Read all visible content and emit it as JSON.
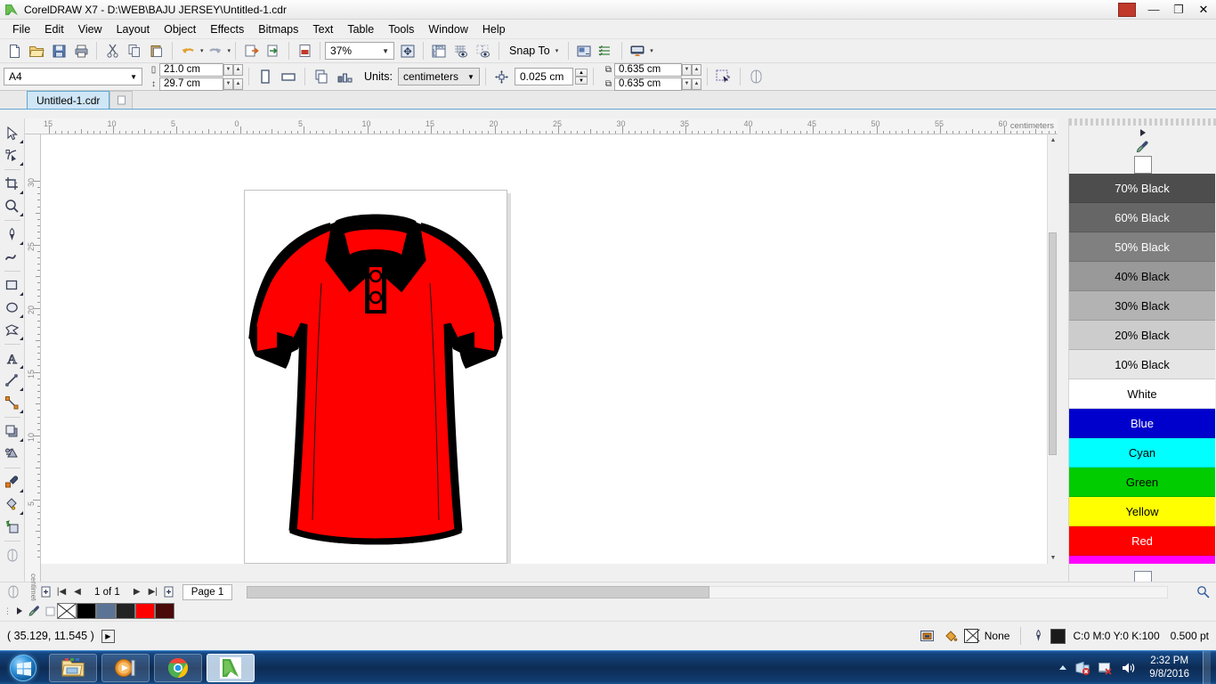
{
  "window": {
    "title": "CorelDRAW X7 - D:\\WEB\\BAJU JERSEY\\Untitled-1.cdr",
    "app_icon": "coreldraw-icon",
    "minimize": "—",
    "maximize": "❐",
    "close": "✕"
  },
  "menu": {
    "items": [
      {
        "label": "File",
        "accel": "F"
      },
      {
        "label": "Edit",
        "accel": "E"
      },
      {
        "label": "View",
        "accel": "V"
      },
      {
        "label": "Layout",
        "accel": "L"
      },
      {
        "label": "Object",
        "accel": "O"
      },
      {
        "label": "Effects",
        "accel": "c"
      },
      {
        "label": "Bitmaps",
        "accel": "B"
      },
      {
        "label": "Text",
        "accel": "x"
      },
      {
        "label": "Table",
        "accel": "T"
      },
      {
        "label": "Tools",
        "accel": "o"
      },
      {
        "label": "Window",
        "accel": "W"
      },
      {
        "label": "Help",
        "accel": "H"
      }
    ]
  },
  "toolbar": {
    "new_label": "new-document",
    "open_label": "open-document",
    "save_label": "save-document",
    "print_label": "print",
    "cut_label": "cut",
    "copy_label": "copy",
    "paste_label": "paste",
    "undo_label": "undo",
    "redo_label": "redo",
    "import_label": "import",
    "export_label": "export",
    "publish_pdf_label": "publish-to-pdf",
    "zoom_value": "37%",
    "fullscreen_label": "full-screen-preview",
    "rulers_label": "show-rulers",
    "grid_label": "show-grid",
    "guides_label": "show-guidelines",
    "snap_to_label": "Snap To",
    "options_label": "options",
    "launch_label": "application-launcher"
  },
  "propertybar": {
    "page_size": "A4",
    "width": "21.0 cm",
    "height": "29.7 cm",
    "portrait_label": "portrait-orientation",
    "landscape_label": "landscape-orientation",
    "all_pages_label": "apply-to-all-pages",
    "current_page_label": "apply-to-current-page",
    "units_label": "Units:",
    "units_value": "centimeters",
    "nudge_value": "0.025 cm",
    "duplicate_x": "0.635 cm",
    "duplicate_y": "0.635 cm",
    "treat_as_filled_label": "treat-all-objects-as-filled",
    "wireframe_label": "wireframe-toggle"
  },
  "document_tabs": {
    "active": "Untitled-1.cdr",
    "add_label": "+"
  },
  "rulers": {
    "units": "centimeters",
    "horizontal_labels": [
      "15",
      "10",
      "5",
      "0",
      "5",
      "10",
      "15",
      "20",
      "25",
      "30",
      "35",
      "40",
      "45",
      "50",
      "55",
      "60"
    ],
    "vertical_labels": [
      "30",
      "25",
      "20",
      "15",
      "10",
      "5"
    ],
    "vertical_units_label": "centimeters"
  },
  "toolbox": {
    "tools": [
      {
        "name": "pick-tool",
        "label": "Pick"
      },
      {
        "name": "shape-tool",
        "label": "Shape"
      },
      {
        "name": "crop-tool",
        "label": "Crop"
      },
      {
        "name": "zoom-tool",
        "label": "Zoom"
      },
      {
        "name": "freehand-tool",
        "label": "Freehand"
      },
      {
        "name": "artistic-media-tool",
        "label": "Artistic Media"
      },
      {
        "name": "rectangle-tool",
        "label": "Rectangle"
      },
      {
        "name": "ellipse-tool",
        "label": "Ellipse"
      },
      {
        "name": "polygon-tool",
        "label": "Polygon"
      },
      {
        "name": "text-tool",
        "label": "Text"
      },
      {
        "name": "parallel-dimension-tool",
        "label": "Parallel Dimension"
      },
      {
        "name": "straight-line-connector-tool",
        "label": "Straight-Line Connector"
      },
      {
        "name": "drop-shadow-tool",
        "label": "Drop Shadow"
      },
      {
        "name": "transparency-tool",
        "label": "Transparency"
      },
      {
        "name": "color-eyedropper-tool",
        "label": "Color Eyedropper"
      },
      {
        "name": "fill-tool",
        "label": "Fill"
      },
      {
        "name": "smart-fill-tool",
        "label": "Smart Fill"
      },
      {
        "name": "interactive-fill-tool",
        "label": "Interactive Fill"
      }
    ]
  },
  "artwork": {
    "name": "red-polo-jersey",
    "body_color": "#FF0000",
    "trim_color": "#000000",
    "description": "Red polo jersey shirt with black collar, black placket, black shoulder panels and black sleeve cuffs"
  },
  "palette": {
    "grip_label": "palette-grip",
    "scroll_up_label": "scroll-up",
    "eyedropper_label": "palette-eyedropper",
    "no_color_label": "no-color",
    "swatches": [
      {
        "label": "70% Black",
        "hex": "#4D4D4D",
        "text": "#FFFFFF"
      },
      {
        "label": "60% Black",
        "hex": "#666666",
        "text": "#FFFFFF"
      },
      {
        "label": "50% Black",
        "hex": "#808080",
        "text": "#FFFFFF"
      },
      {
        "label": "40% Black",
        "hex": "#999999",
        "text": "#000000"
      },
      {
        "label": "30% Black",
        "hex": "#B3B3B3",
        "text": "#000000"
      },
      {
        "label": "20% Black",
        "hex": "#CCCCCC",
        "text": "#000000"
      },
      {
        "label": "10% Black",
        "hex": "#E6E6E6",
        "text": "#000000"
      },
      {
        "label": "White",
        "hex": "#FFFFFF",
        "text": "#000000"
      },
      {
        "label": "Blue",
        "hex": "#0000CC",
        "text": "#FFFFFF"
      },
      {
        "label": "Cyan",
        "hex": "#00FFFF",
        "text": "#000000"
      },
      {
        "label": "Green",
        "hex": "#00CC00",
        "text": "#000000"
      },
      {
        "label": "Yellow",
        "hex": "#FFFF00",
        "text": "#000000"
      },
      {
        "label": "Red",
        "hex": "#FF0000",
        "text": "#FFFFFF"
      }
    ],
    "partial_strip": {
      "label": "Magenta",
      "hex": "#FF00FF"
    },
    "expand_label": "»"
  },
  "pagenav": {
    "add_page_start_label": "add-page-before",
    "first_label": "|◀",
    "prev_label": "◀",
    "counter": "1 of 1",
    "next_label": "▶",
    "last_label": "▶|",
    "add_page_end_label": "add-page-after",
    "page_tab": "Page 1"
  },
  "minipalette": {
    "swatches": [
      {
        "name": "none",
        "hex": "#FFFFFF"
      },
      {
        "name": "black",
        "hex": "#000000"
      },
      {
        "name": "slate-blue",
        "hex": "#5B7496"
      },
      {
        "name": "dark-charcoal",
        "hex": "#232323"
      },
      {
        "name": "red",
        "hex": "#FF0000"
      },
      {
        "name": "dark-red",
        "hex": "#4A0A0A"
      }
    ]
  },
  "statusbar": {
    "coordinates": "( 35.129, 11.545 )",
    "snap_toggle_label": "snap-indicator",
    "color_proof_label": "color-proof",
    "fill_icon_label": "fill-bucket-icon",
    "fill_value": "None",
    "outline_icon_label": "outline-pen-icon",
    "outline_color_hex": "#1A1A1A",
    "outline_value": "C:0 M:0 Y:0 K:100",
    "outline_width": "0.500 pt"
  },
  "taskbar": {
    "start_label": "start-orb",
    "apps": [
      {
        "name": "windows-explorer",
        "label": "Windows Explorer"
      },
      {
        "name": "windows-media-player",
        "label": "Windows Media Player"
      },
      {
        "name": "google-chrome",
        "label": "Google Chrome"
      },
      {
        "name": "coreldraw-x7",
        "label": "CorelDRAW X7"
      }
    ],
    "tray": {
      "show_hidden_label": "show-hidden-icons",
      "network_label": "network-disconnected",
      "action_center_label": "action-center-alert",
      "volume_label": "volume"
    },
    "time": "2:32 PM",
    "date": "9/8/2016",
    "show_desktop_label": "show-desktop"
  }
}
